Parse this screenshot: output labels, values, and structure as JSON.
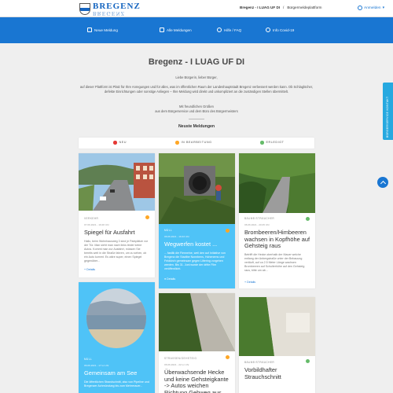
{
  "header": {
    "logo_text": "BREGENZ",
    "breadcrumb_current": "Bregenz - I LUAG UF DI",
    "breadcrumb_separator": "/",
    "breadcrumb_parent": "Bürgermeldeplattform",
    "login_label": "Anmelden"
  },
  "nav": {
    "items": [
      {
        "label": "Neue Meldung",
        "icon": "pencil-icon"
      },
      {
        "label": "Alle Meldungen",
        "icon": "list-icon"
      },
      {
        "label": "Hilfe / FAQ",
        "icon": "help-icon"
      },
      {
        "label": "Info Covid-19",
        "icon": "info-icon"
      }
    ]
  },
  "intro": {
    "title": "Bregenz - I LUAG UF DI",
    "greeting": "Liebe Bürgerin, lieber Bürger,",
    "paragraph": "auf dieser Plattform ist Platz für Ihre Anregungen und für alles, was im öffentlichen Raum der Landeshauptstadt Bregenz verbessert werden kann. Ob Schlaglöcher, defekte Einrichtungen oder sonstige Anliegen – Ihre Meldung wird direkt und unkompliziert an die zuständigen Stellen übermittelt.",
    "closing_1": "Mit freundlichen Grüßen",
    "closing_2": "aus dem Bürgerservice und dem Büro des Bürgermeisters",
    "section_title": "Neuste Meldungen"
  },
  "filters": [
    {
      "label": "NEU",
      "color": "#e53935"
    },
    {
      "label": "IN BEARBEITUNG",
      "color": "#ffa726"
    },
    {
      "label": "ERLEDIGT",
      "color": "#66bb6a"
    }
  ],
  "cards": {
    "c1": {
      "category": "VERKEHR",
      "date": "07.06.2021 - 16:28 Uhr",
      "title": "Spiegel für Ausfahrt",
      "text": "Hallo, beim Wohnhausweg 3 sind je Parkplätze vor der Tür. Man sieht man nach links leider keine Autos. Kommt man zur Ausfahrt, müssen Sie bereits weit in die Straße fahren, um zu sehen, ob ein Auto kommt. Es wäre super, einen Spiegel gegenüber...",
      "more": "Details",
      "status_color": "#ffa726"
    },
    "c2": {
      "category": "MÜLL",
      "date": "06.06.2021 - 16:43 Uhr",
      "title": "Wegwerfen kostet ...",
      "text": "... fastlik die Flennelne, weil den auf Initiative von Bregenz die Stadtbe Nonnbens, Hohenems und Feldkirch gemeinsam gegen Littering vorgehen werden. Bis 31. Juni wurde der dritte Film veröffentlicht.",
      "more": "Details",
      "status_color": "#ffa726"
    },
    "c3": {
      "category": "BÄUME/STRÄUCHER",
      "date": "06.06.2021 - 20:45 Uhr",
      "title": "Brombeeren/Himbeeren wachsen in Kopfhöhe auf Gehsteig raus",
      "text": "Betrifft die Hecke oberhalb der Mauer welche entlang der Anbergstraße unter der Bebauung verläuft, auf ca 2.5 Meter Länge wachsen Brombeeren auf Schulterhöhe auf den Gehsteig raus, bitte um ab...",
      "more": "Details",
      "status_color": "#66bb6a"
    },
    "c4": {
      "category": "MÜLL",
      "date": "06.06.2021 - 17:xx Uhr",
      "title": "Gemeinsam am See",
      "text": "Die öffentlichen Strandschnitt, also von Pipeline und Bregenzer Achmündung bis zum Mehrerauer..."
    },
    "c5": {
      "category": "STRASSEN/GEHSTEIG",
      "date": "06.06.2021 - 22:xx Uhr",
      "title": "Überwachsende Hecke und keine Gehsteigkante -> Autos weichen Richtung Gehweg aus",
      "status_color": "#ffa726"
    },
    "c6": {
      "category": "BÄUME/STRÄUCHER",
      "title": "Vorbildhafter Strauchschnitt",
      "status_color": "#66bb6a"
    }
  },
  "side_tab_label": "BÜRGERSERVICE KONTAKT"
}
